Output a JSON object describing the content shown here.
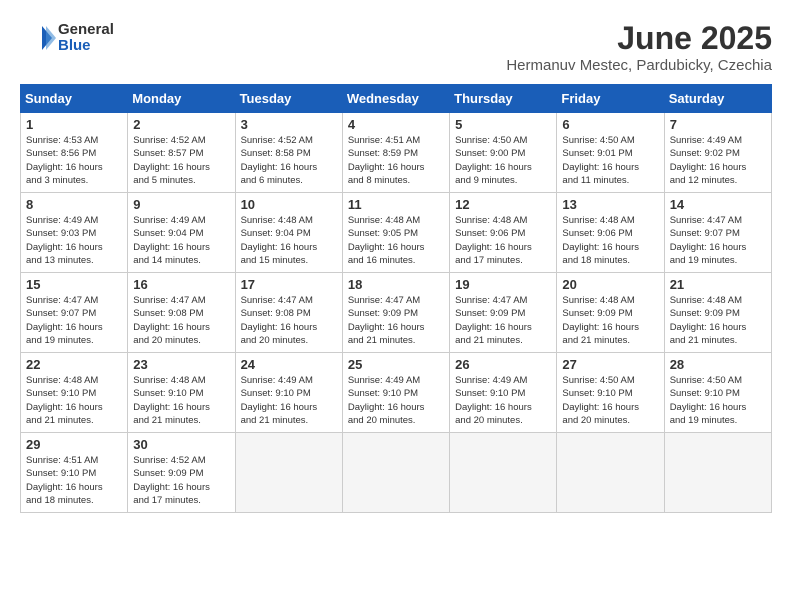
{
  "header": {
    "logo_general": "General",
    "logo_blue": "Blue",
    "month_year": "June 2025",
    "location": "Hermanuv Mestec, Pardubicky, Czechia"
  },
  "days_of_week": [
    "Sunday",
    "Monday",
    "Tuesday",
    "Wednesday",
    "Thursday",
    "Friday",
    "Saturday"
  ],
  "weeks": [
    [
      {
        "day": "1",
        "sunrise": "4:53 AM",
        "sunset": "8:56 PM",
        "daylight": "16 hours and 3 minutes."
      },
      {
        "day": "2",
        "sunrise": "4:52 AM",
        "sunset": "8:57 PM",
        "daylight": "16 hours and 5 minutes."
      },
      {
        "day": "3",
        "sunrise": "4:52 AM",
        "sunset": "8:58 PM",
        "daylight": "16 hours and 6 minutes."
      },
      {
        "day": "4",
        "sunrise": "4:51 AM",
        "sunset": "8:59 PM",
        "daylight": "16 hours and 8 minutes."
      },
      {
        "day": "5",
        "sunrise": "4:50 AM",
        "sunset": "9:00 PM",
        "daylight": "16 hours and 9 minutes."
      },
      {
        "day": "6",
        "sunrise": "4:50 AM",
        "sunset": "9:01 PM",
        "daylight": "16 hours and 11 minutes."
      },
      {
        "day": "7",
        "sunrise": "4:49 AM",
        "sunset": "9:02 PM",
        "daylight": "16 hours and 12 minutes."
      }
    ],
    [
      {
        "day": "8",
        "sunrise": "4:49 AM",
        "sunset": "9:03 PM",
        "daylight": "16 hours and 13 minutes."
      },
      {
        "day": "9",
        "sunrise": "4:49 AM",
        "sunset": "9:04 PM",
        "daylight": "16 hours and 14 minutes."
      },
      {
        "day": "10",
        "sunrise": "4:48 AM",
        "sunset": "9:04 PM",
        "daylight": "16 hours and 15 minutes."
      },
      {
        "day": "11",
        "sunrise": "4:48 AM",
        "sunset": "9:05 PM",
        "daylight": "16 hours and 16 minutes."
      },
      {
        "day": "12",
        "sunrise": "4:48 AM",
        "sunset": "9:06 PM",
        "daylight": "16 hours and 17 minutes."
      },
      {
        "day": "13",
        "sunrise": "4:48 AM",
        "sunset": "9:06 PM",
        "daylight": "16 hours and 18 minutes."
      },
      {
        "day": "14",
        "sunrise": "4:47 AM",
        "sunset": "9:07 PM",
        "daylight": "16 hours and 19 minutes."
      }
    ],
    [
      {
        "day": "15",
        "sunrise": "4:47 AM",
        "sunset": "9:07 PM",
        "daylight": "16 hours and 19 minutes."
      },
      {
        "day": "16",
        "sunrise": "4:47 AM",
        "sunset": "9:08 PM",
        "daylight": "16 hours and 20 minutes."
      },
      {
        "day": "17",
        "sunrise": "4:47 AM",
        "sunset": "9:08 PM",
        "daylight": "16 hours and 20 minutes."
      },
      {
        "day": "18",
        "sunrise": "4:47 AM",
        "sunset": "9:09 PM",
        "daylight": "16 hours and 21 minutes."
      },
      {
        "day": "19",
        "sunrise": "4:47 AM",
        "sunset": "9:09 PM",
        "daylight": "16 hours and 21 minutes."
      },
      {
        "day": "20",
        "sunrise": "4:48 AM",
        "sunset": "9:09 PM",
        "daylight": "16 hours and 21 minutes."
      },
      {
        "day": "21",
        "sunrise": "4:48 AM",
        "sunset": "9:09 PM",
        "daylight": "16 hours and 21 minutes."
      }
    ],
    [
      {
        "day": "22",
        "sunrise": "4:48 AM",
        "sunset": "9:10 PM",
        "daylight": "16 hours and 21 minutes."
      },
      {
        "day": "23",
        "sunrise": "4:48 AM",
        "sunset": "9:10 PM",
        "daylight": "16 hours and 21 minutes."
      },
      {
        "day": "24",
        "sunrise": "4:49 AM",
        "sunset": "9:10 PM",
        "daylight": "16 hours and 21 minutes."
      },
      {
        "day": "25",
        "sunrise": "4:49 AM",
        "sunset": "9:10 PM",
        "daylight": "16 hours and 20 minutes."
      },
      {
        "day": "26",
        "sunrise": "4:49 AM",
        "sunset": "9:10 PM",
        "daylight": "16 hours and 20 minutes."
      },
      {
        "day": "27",
        "sunrise": "4:50 AM",
        "sunset": "9:10 PM",
        "daylight": "16 hours and 20 minutes."
      },
      {
        "day": "28",
        "sunrise": "4:50 AM",
        "sunset": "9:10 PM",
        "daylight": "16 hours and 19 minutes."
      }
    ],
    [
      {
        "day": "29",
        "sunrise": "4:51 AM",
        "sunset": "9:10 PM",
        "daylight": "16 hours and 18 minutes."
      },
      {
        "day": "30",
        "sunrise": "4:52 AM",
        "sunset": "9:09 PM",
        "daylight": "16 hours and 17 minutes."
      },
      null,
      null,
      null,
      null,
      null
    ]
  ],
  "labels": {
    "sunrise": "Sunrise:",
    "sunset": "Sunset:",
    "daylight": "Daylight:"
  }
}
